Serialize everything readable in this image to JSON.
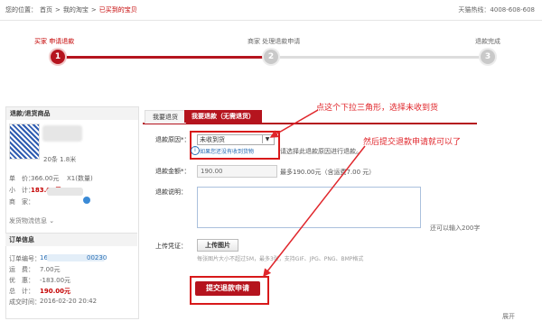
{
  "breadcrumb": {
    "prefix": "您的位置：",
    "items": [
      "首页",
      "我的淘宝",
      "已买到的宝贝"
    ],
    "sep": ">"
  },
  "hotline": "天猫热线：4008-608-608",
  "steps": [
    {
      "label": "买家 申请退款",
      "num": "1",
      "state": "done"
    },
    {
      "label": "商家 处理退款申请",
      "num": "2",
      "state": "todo"
    },
    {
      "label": "退款完成",
      "num": "3",
      "state": "todo"
    }
  ],
  "left_panel": {
    "header": "退款/退货商品",
    "qty": "20条 1.8米",
    "price_label": "单　价：",
    "price": "366.00元",
    "qty_label": "X1(数量)",
    "subtotal_label": "小　计：",
    "subtotal": "183.00元",
    "seller_label": "商　家：",
    "shipping": "发货物流信息",
    "order_header": "订单信息",
    "order_no_label": "订单编号：",
    "order_no_a": "16",
    "order_no_b": "00230",
    "freight_label": "运　费：",
    "freight": "7.00元",
    "discount_label": "优　惠：",
    "discount": "-183.00元",
    "total_label": "总　计：",
    "total": "190.00元",
    "time_label": "成交时间：",
    "time": "2016-02-20 20:42"
  },
  "tabs": [
    {
      "label": "我要退货"
    },
    {
      "label": "我要退款（无需退货）"
    }
  ],
  "form": {
    "reason_label": "退款原因*：",
    "reason_value": "未收到货",
    "reason_hint": "请选择此退款原因进行退款。",
    "reason_info": "如果您还没有收到货物",
    "amount_label": "退款金额*：",
    "amount_value": "190.00",
    "amount_note": "最多190.00元（含运费7.00 元）",
    "desc_label": "退款说明：",
    "desc_counter": "还可以输入200字",
    "upload_label": "上传凭证：",
    "upload_btn": "上传图片",
    "upload_note": "每张图片大小不超过5M，最多3张，支持GIF、JPG、PNG、BMP格式",
    "submit": "提交退款申请"
  },
  "annotations": {
    "a1": "点这个下拉三角形，选择未收到货",
    "a2": "然后提交退款申请就可以了",
    "color": "#e0262b"
  },
  "footer_right": "展开"
}
